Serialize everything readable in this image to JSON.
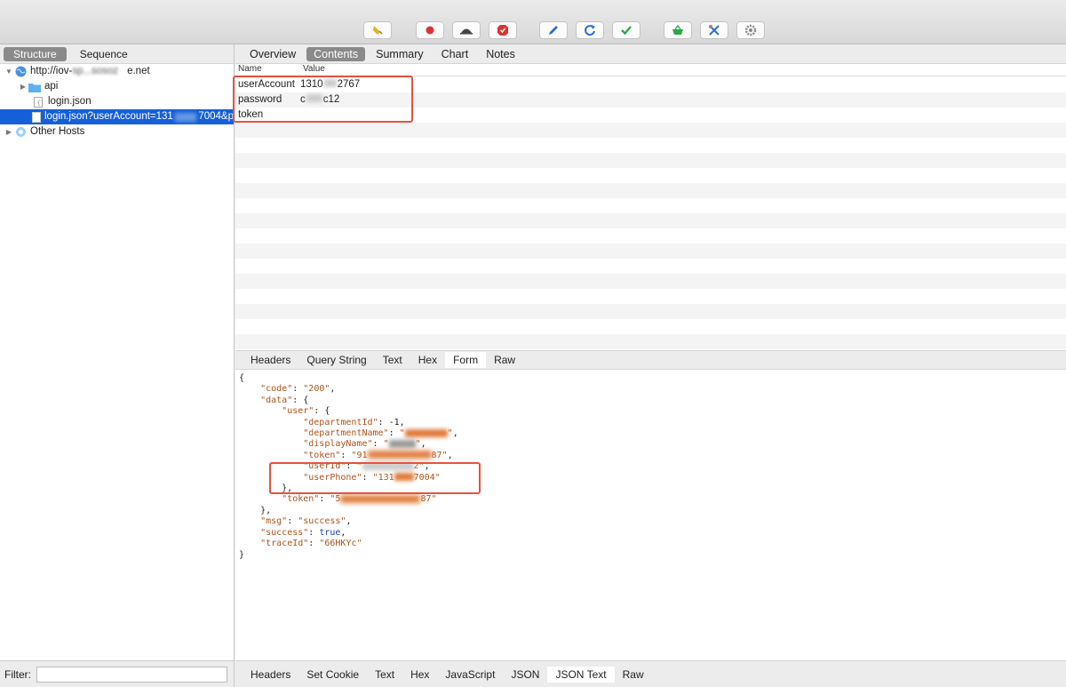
{
  "toolbar": {
    "buttons": [
      {
        "name": "broom-icon",
        "color": "#e3b21e"
      },
      {
        "name": "record-icon",
        "color": "#e03232"
      },
      {
        "name": "turtle-icon",
        "color": "#444444"
      },
      {
        "name": "stop-breakpoint-icon",
        "color": "#e03232"
      },
      {
        "name": "pen-icon",
        "color": "#2b6fd6"
      },
      {
        "name": "refresh-icon",
        "color": "#2b6fd6"
      },
      {
        "name": "check-icon",
        "color": "#2aa84a"
      },
      {
        "name": "basket-icon",
        "color": "#2aa84a"
      },
      {
        "name": "tools-icon",
        "color": "#2b6fd6"
      },
      {
        "name": "settings-icon",
        "color": "#888888"
      }
    ]
  },
  "left": {
    "tabs": [
      "Structure",
      "Sequence"
    ],
    "tree": {
      "host": "http://iov-",
      "host_obscured": "sp...sosoz",
      "host_suffix": "e.net",
      "api": "api",
      "login": "login.json",
      "login_query": "login.json?userAccount=131",
      "login_query_tail": "7004&p",
      "other": "Other Hosts"
    },
    "filter_label": "Filter:",
    "filter_value": ""
  },
  "right": {
    "tabs": [
      "Overview",
      "Contents",
      "Summary",
      "Chart",
      "Notes"
    ],
    "columns": {
      "name": "Name",
      "value": "Value"
    },
    "params": [
      {
        "name": "userAccount",
        "value": "1310",
        "value_tail": "2767"
      },
      {
        "name": "password",
        "value": "c",
        "value_tail": "c12"
      },
      {
        "name": "token",
        "value": ""
      }
    ],
    "request_tabs": [
      "Headers",
      "Query String",
      "Text",
      "Hex",
      "Form",
      "Raw"
    ],
    "response_tabs": [
      "Headers",
      "Set Cookie",
      "Text",
      "Hex",
      "JavaScript",
      "JSON",
      "JSON Text",
      "Raw"
    ]
  },
  "response": {
    "code": "200",
    "departmentId": "-1",
    "token_user": "91",
    "token_user_tail": "87",
    "userId": "2",
    "userPhone_head": "131",
    "userPhone_tail": "7004",
    "token_data": "5",
    "token_data_tail": "87",
    "msg": "success",
    "success": "true",
    "traceId": "66HKYc"
  },
  "colors": {
    "selection": "#1560d9",
    "highlight": "#e5523f",
    "json_key": "#b0521c",
    "json_bool": "#1a3fb5"
  }
}
